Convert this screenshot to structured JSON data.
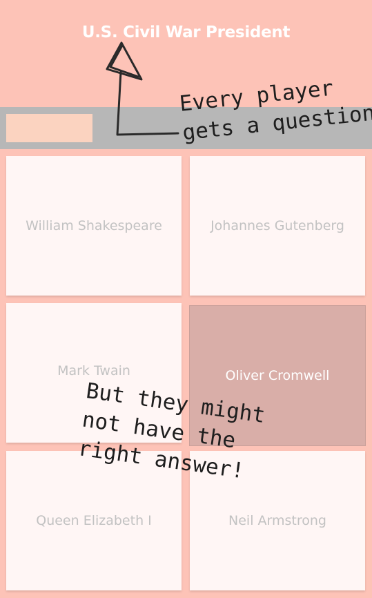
{
  "question": "U.S. Civil War President",
  "timer": {
    "remaining_fraction": 0.24
  },
  "answers": [
    {
      "label": "William Shakespeare",
      "selected": false
    },
    {
      "label": "Johannes Gutenberg",
      "selected": false
    },
    {
      "label": "Mark Twain",
      "selected": false
    },
    {
      "label": "Oliver Cromwell",
      "selected": true
    },
    {
      "label": "Queen Elizabeth I",
      "selected": false
    },
    {
      "label": "Neil Armstrong",
      "selected": false
    }
  ],
  "annotations": {
    "top": "Every player\ngets a question",
    "bottom": "But they might\nnot have the\nright answer!"
  },
  "colors": {
    "background": "#fdc3b7",
    "timer_track": "#b7b7b7",
    "timer_fill": "#fbd3c0",
    "card": "#fff6f5",
    "card_selected": "#d9aea8"
  }
}
